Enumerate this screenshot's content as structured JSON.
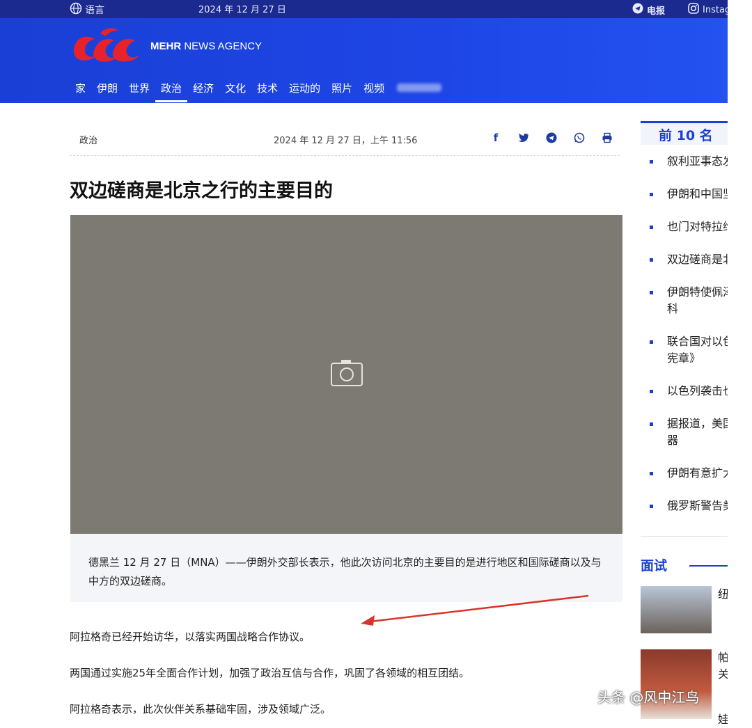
{
  "topbar": {
    "language": "语言",
    "date": "2024 年 12 月 27 日",
    "telegram": "电报",
    "instagram": "Instagram"
  },
  "header": {
    "brand_bold": "MEHR",
    "brand_rest": " NEWS AGENCY",
    "nav": [
      "家",
      "伊朗",
      "世界",
      "政治",
      "经济",
      "文化",
      "技术",
      "运动的",
      "照片",
      "视频"
    ],
    "nav_active": "政治",
    "brand_color": "#1e46e6"
  },
  "article": {
    "category": "政治",
    "published": "2024 年 12 月 27 日，上午 11:56",
    "share_icons": [
      "facebook-icon",
      "twitter-icon",
      "telegram-icon",
      "whatsapp-icon",
      "print-icon"
    ],
    "title": "双边磋商是北京之行的主要目的",
    "caption": "德黑兰 12 月 27 日（MNA）——伊朗外交部长表示，他此次访问北京的主要目的是进行地区和国际磋商以及与中方的双边磋商。",
    "paragraphs": [
      "阿拉格奇已经开始访华，以落实两国战略合作协议。",
      "两国通过实施25年全面合作计划，加强了政治互信与合作，巩固了各领域的相互团结。",
      "阿拉格奇表示，此次伙伴关系基础牢固，涉及领域广泛。"
    ]
  },
  "sidebar": {
    "top_title": "前 10 名",
    "top_items": [
      "叙利亚事态发",
      "伊朗和中国坚",
      "也门对特拉维",
      "双边磋商是北",
      "伊朗特使佩泽",
      "科",
      "联合国对以色",
      "宪章》",
      "以色列袭击也",
      "据报道，美国",
      "器",
      "伊朗有意扩大",
      "俄罗斯警告美"
    ],
    "interview_title": "面试",
    "thumb_texts": [
      "纽",
      "帕",
      "关",
      "娃"
    ]
  },
  "watermark": "头条 @风中江鸟"
}
